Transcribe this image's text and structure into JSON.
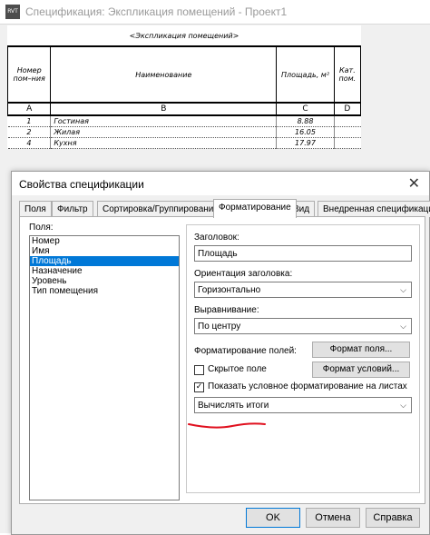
{
  "window": {
    "app_icon": "RVT",
    "title": "Спецификация: Экспликация помещений - Проект1"
  },
  "schedule": {
    "title": "<Экспликация помещений>",
    "headers": [
      "Номер пом–ния",
      "Наименование",
      "Площадь, м²",
      "Кат. пом."
    ],
    "letters": [
      "A",
      "B",
      "C",
      "D"
    ],
    "rows": [
      [
        "1",
        "Гостиная",
        "8.88",
        ""
      ],
      [
        "2",
        "Жилая",
        "16.05",
        ""
      ],
      [
        "4",
        "Кухня",
        "17.97",
        ""
      ]
    ]
  },
  "dialog": {
    "title": "Свойства спецификации",
    "close": "✕",
    "tabs": [
      "Поля",
      "Фильтр",
      "Сортировка/Группирование",
      "Форматирование",
      "Вид",
      "Внедренная спецификация"
    ],
    "active_tab": "Форматирование",
    "fields_label": "Поля:",
    "fields": [
      "Номер",
      "Имя",
      "Площадь",
      "Назначение",
      "Уровень",
      "Тип помещения"
    ],
    "selected_field": "Площадь",
    "heading_label": "Заголовок:",
    "heading_value": "Площадь",
    "orientation_label": "Ориентация заголовка:",
    "orientation_value": "Горизонтально",
    "alignment_label": "Выравнивание:",
    "alignment_value": "По центру",
    "field_format_label": "Форматирование полей:",
    "field_format_button": "Формат поля...",
    "hidden_field_label": "Скрытое поле",
    "hidden_field_checked": false,
    "conditional_format_button": "Формат условий...",
    "show_conditional_label": "Показать условное форматирование на листах",
    "show_conditional_checked": true,
    "totals_value": "Вычислять итоги",
    "accent_color": "#0078d7",
    "mark_color": "#e0101e"
  },
  "footer": {
    "ok": "OK",
    "cancel": "Отмена",
    "help": "Справка"
  }
}
